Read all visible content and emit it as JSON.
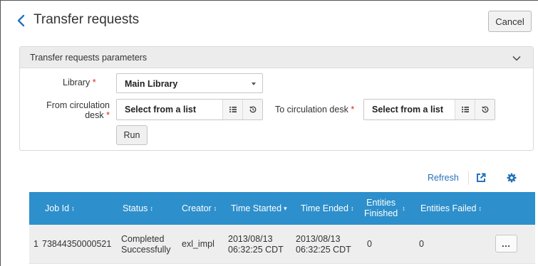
{
  "header": {
    "title": "Transfer requests",
    "cancel_label": "Cancel"
  },
  "params": {
    "title": "Transfer requests parameters",
    "library_label": "Library",
    "library_value": "Main Library",
    "from_label_line1": "From circulation",
    "from_label_line2": "desk",
    "from_value": "Select from a list",
    "to_label": "To circulation desk",
    "to_value": "Select from a list",
    "required_marker": "*",
    "run_label": "Run"
  },
  "toolbar": {
    "refresh_label": "Refresh",
    "icons": [
      "export-icon",
      "gear-icon"
    ]
  },
  "table": {
    "columns": [
      {
        "label": "Job Id",
        "sort": "↕"
      },
      {
        "label": "Status",
        "sort": "↕"
      },
      {
        "label": "Creator",
        "sort": "↕"
      },
      {
        "label": "Time Started",
        "sort": "▾"
      },
      {
        "label": "Time Ended",
        "sort": "↕"
      },
      {
        "label_line1": "Entities",
        "label_line2": "Finished",
        "sort": "↕"
      },
      {
        "label": "Entities Failed",
        "sort": "↕"
      }
    ],
    "rows": [
      {
        "index": "1",
        "job_id": "73844350000521",
        "status_line1": "Completed",
        "status_line2": "Successfully",
        "creator": "exl_impl",
        "started_line1": "2013/08/13",
        "started_line2": "06:32:25 CDT",
        "ended_line1": "2013/08/13",
        "ended_line2": "06:32:25 CDT",
        "entities_finished": "0",
        "entities_failed": "0",
        "more_label": "…"
      }
    ]
  },
  "colors": {
    "accent": "#2d8fcb",
    "link": "#2573b9",
    "required": "#d52b1e"
  }
}
